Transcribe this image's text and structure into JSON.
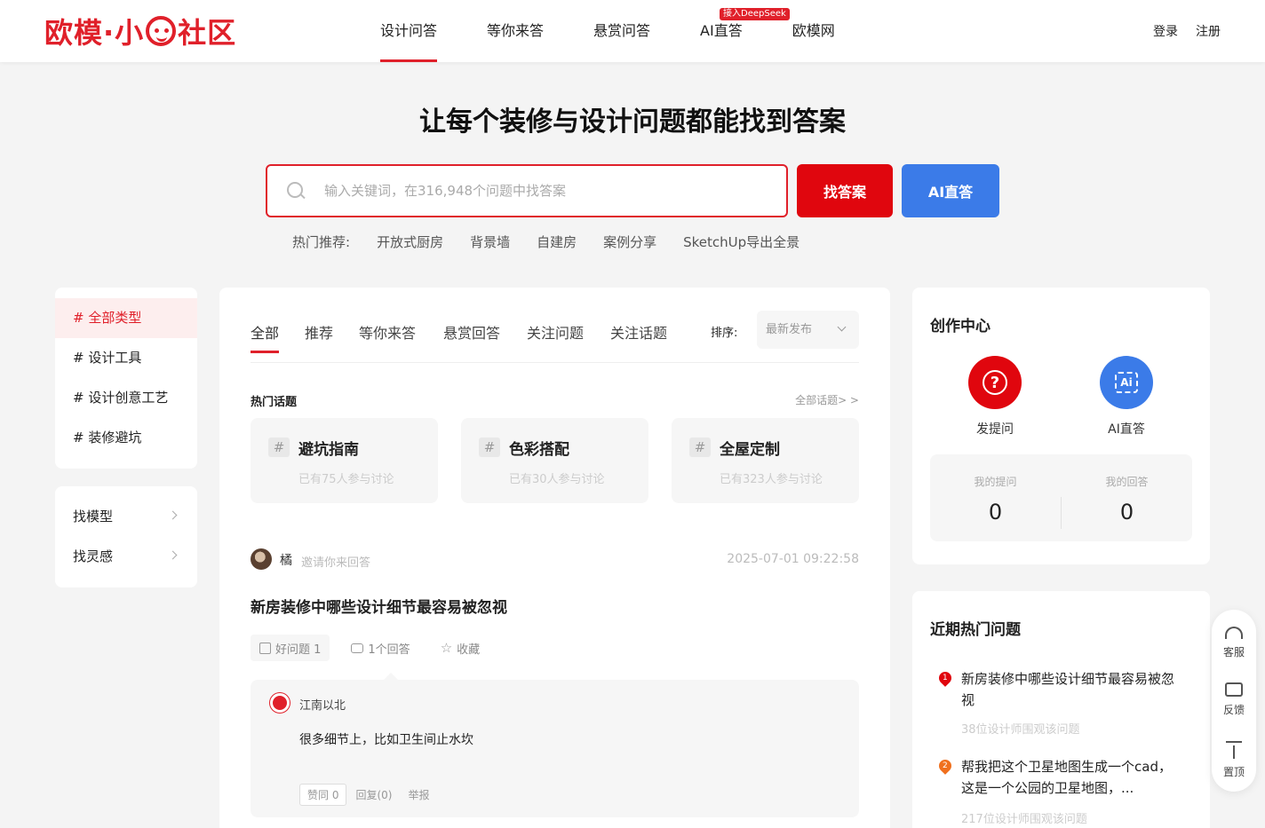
{
  "header": {
    "logo_text": "欧模·小",
    "logo_text2": "社区",
    "nav": [
      {
        "label": "设计问答",
        "active": true
      },
      {
        "label": "等你来答"
      },
      {
        "label": "悬赏问答"
      },
      {
        "label": "AI直答",
        "badge": "接入DeepSeek"
      },
      {
        "label": "欧模网"
      }
    ],
    "login": "登录",
    "register": "注册"
  },
  "hero": {
    "title": "让每个装修与设计问题都能找到答案",
    "search_placeholder": "输入关键词，在316,948个问题中找答案",
    "find_button": "找答案",
    "ai_button": "AI直答",
    "hot_label": "热门推荐:",
    "hot_tags": [
      "开放式厨房",
      "背景墙",
      "自建房",
      "案例分享",
      "SketchUp导出全景"
    ]
  },
  "sidebar": {
    "categories": [
      "# 全部类型",
      "# 设计工具",
      "# 设计创意工艺",
      "# 装修避坑"
    ],
    "links": [
      "找模型",
      "找灵感"
    ]
  },
  "main": {
    "tabs": [
      "全部",
      "推荐",
      "等你来答",
      "悬赏回答",
      "关注问题",
      "关注话题"
    ],
    "sort_label": "排序:",
    "sort_value": "最新发布",
    "hot_topics_title": "热门话题",
    "all_topics": "全部话题> >",
    "topics": [
      {
        "hash": "#",
        "name": "避坑指南",
        "count": "已有75人参与讨论"
      },
      {
        "hash": "#",
        "name": "色彩搭配",
        "count": "已有30人参与讨论"
      },
      {
        "hash": "#",
        "name": "全屋定制",
        "count": "已有323人参与讨论"
      }
    ],
    "question": {
      "user": "橘",
      "invite": "邀请你来回答",
      "time": "2025-07-01 09:22:58",
      "title": "新房装修中哪些设计细节最容易被忽视",
      "good": "好问题 1",
      "answers": "1个回答",
      "favorite": "收藏"
    },
    "answer": {
      "user": "江南以北",
      "text": "很多细节上，比如卫生间止水坎",
      "like": "赞同 0",
      "reply": "回复(0)",
      "report": "举报"
    }
  },
  "create_center": {
    "title": "创作中心",
    "ask_icon": "?",
    "ask_label": "发提问",
    "ai_icon": "Ai",
    "ai_label": "AI直答",
    "my_questions_label": "我的提问",
    "my_questions_value": "0",
    "my_answers_label": "我的回答",
    "my_answers_value": "0"
  },
  "hot_questions": {
    "title": "近期热门问题",
    "items": [
      {
        "rank": "1",
        "text": "新房装修中哪些设计细节最容易被忽视",
        "views": "38位设计师围观该问题"
      },
      {
        "rank": "2",
        "text": "帮我把这个卫星地图生成一个cad，这是一个公园的卫星地图，...",
        "views": "217位设计师围观该问题"
      }
    ]
  },
  "float_bar": {
    "service": "客服",
    "feedback": "反馈",
    "top": "置顶"
  }
}
